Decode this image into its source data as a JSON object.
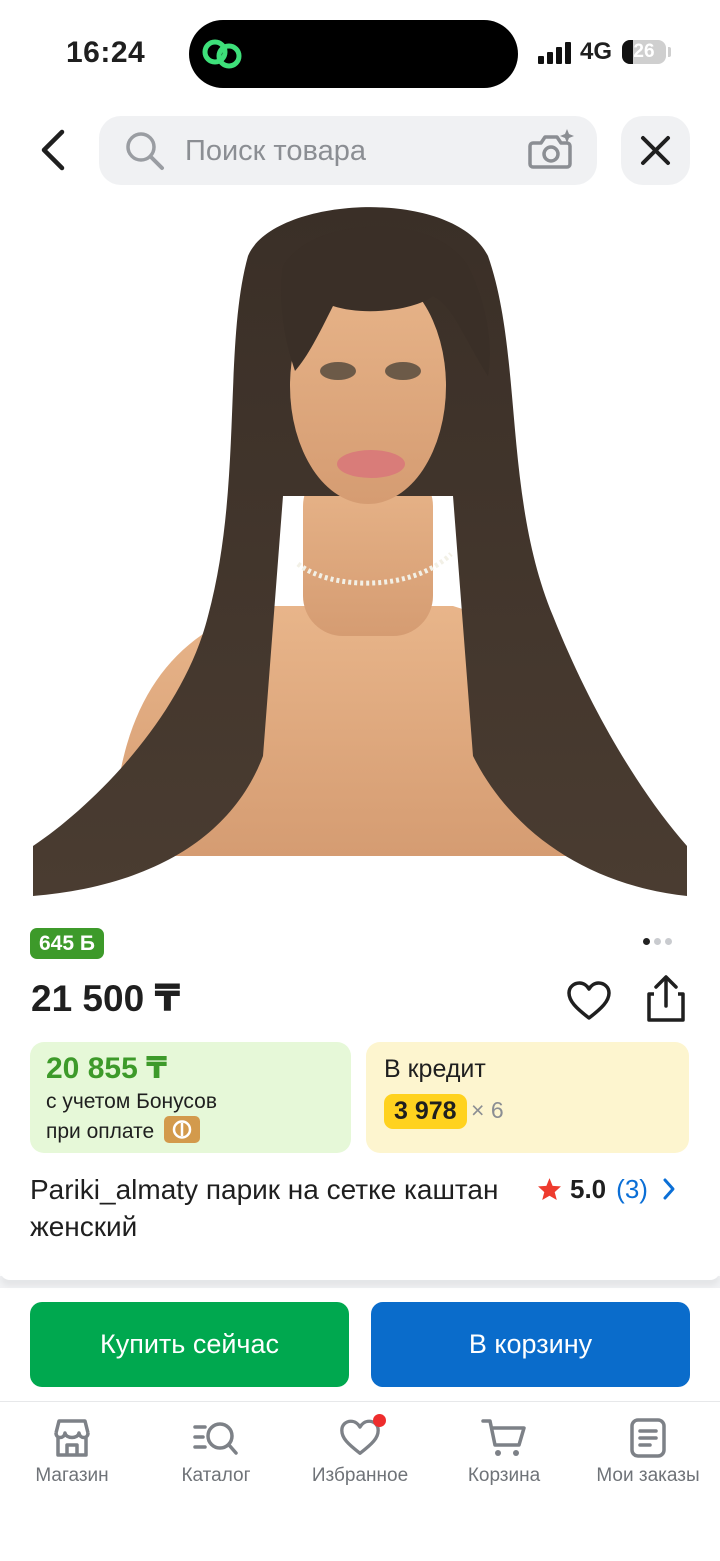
{
  "status_bar": {
    "time": "16:24",
    "network": "4G",
    "battery": "26",
    "battery_level": 0.26
  },
  "header": {
    "search_placeholder": "Поиск товара"
  },
  "product": {
    "bonus_badge": "645 Б",
    "gallery_dots": 3,
    "price": "21 500 ₸",
    "bonus_card": {
      "price": "20 855 ₸",
      "line1": "с учетом Бонусов",
      "line2": "при оплате"
    },
    "credit_card": {
      "title": "В кредит",
      "amount": "3 978",
      "times": "× 6"
    },
    "title": "Pariki_almaty парик на сетке каштан женский",
    "rating": {
      "value": "5.0",
      "count": "(3)"
    }
  },
  "actions": {
    "buy_now": "Купить сейчас",
    "add_to_cart": "В корзину"
  },
  "bottom_nav": [
    {
      "label": "Магазин",
      "icon": "store-icon"
    },
    {
      "label": "Каталог",
      "icon": "catalog-icon"
    },
    {
      "label": "Избранное",
      "icon": "heart-icon"
    },
    {
      "label": "Корзина",
      "icon": "cart-icon"
    },
    {
      "label": "Мои заказы",
      "icon": "orders-icon"
    }
  ],
  "colors": {
    "bonus_green": "#3d9a2a",
    "buy_green": "#00a84f",
    "cart_blue": "#0a6ccb",
    "credit_yellow": "#ffd21f",
    "rating_star": "#ee3b2e"
  }
}
